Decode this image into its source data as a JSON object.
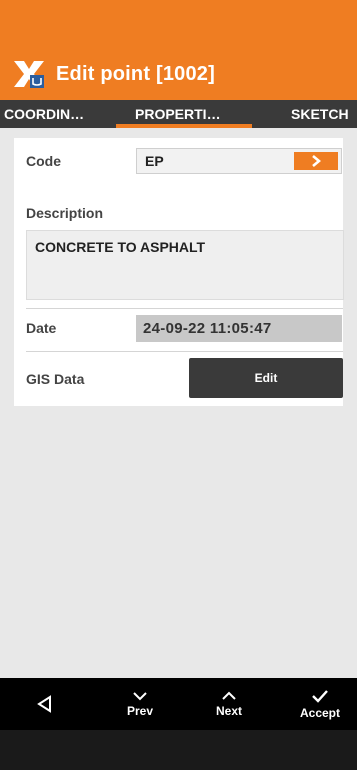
{
  "header": {
    "title": "Edit point [1002]",
    "accent_color": "#ef7d22",
    "icon": "app-logo-icon"
  },
  "tabs": [
    {
      "label": "COORDIN…",
      "selected": false
    },
    {
      "label": "PROPERTI…",
      "selected": true
    },
    {
      "label": "SKETCH",
      "selected": false
    }
  ],
  "form": {
    "code_label": "Code",
    "code_value": "EP",
    "code_action_icon": "chevron-right-icon",
    "description_label": "Description",
    "description_value": "CONCRETE TO ASPHALT",
    "date_label": "Date",
    "date_value": "24-09-22  11:05:47",
    "gis_label": "GIS Data",
    "gis_button": "Edit"
  },
  "bottom_bar": {
    "back_icon": "back-triangle-icon",
    "prev_label": "Prev",
    "next_label": "Next",
    "accept_label": "Accept"
  }
}
